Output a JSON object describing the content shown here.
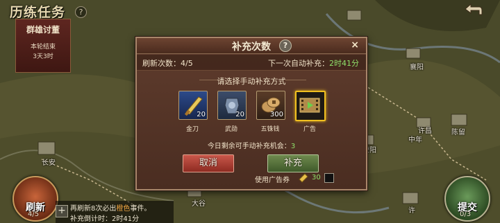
{
  "header": {
    "title": "历练任务",
    "help": "?"
  },
  "banner": {
    "title": "群雄讨董",
    "round_status": "本轮结束",
    "time_left": "3天3时"
  },
  "map_cities": [
    "襄阳",
    "陈留",
    "许昌",
    "中年",
    "荥阳",
    "长安",
    "大谷",
    "许"
  ],
  "dialog": {
    "title": "补充次数",
    "help": "?",
    "close": "×",
    "refresh_count_label": "刷新次数：",
    "refresh_count_value": "4/5",
    "next_auto_label": "下一次自动补充：",
    "next_auto_value": "2时41分",
    "choose_prompt": "请选择手动补充方式",
    "items": [
      {
        "name": "金刀",
        "count": "20",
        "icon": "golden-blade-icon"
      },
      {
        "name": "武勋",
        "count": "20",
        "icon": "military-merit-icon"
      },
      {
        "name": "五铢钱",
        "count": "300",
        "icon": "coin-icon"
      },
      {
        "name": "广告",
        "count": "",
        "icon": "ad-film-icon"
      }
    ],
    "remaining_label": "今日剩余可手动补充机会：",
    "remaining_value": "3",
    "cancel_label": "取消",
    "refill_label": "补充",
    "use_ad_ticket_label": "使用广告券",
    "ad_ticket_count": "30"
  },
  "refresh_button": {
    "label": "刷新",
    "count": "4/5"
  },
  "submit_button": {
    "label": "提交",
    "count": "0/3"
  },
  "bottom_tip": {
    "line1_prefix": "再刷新8次必出",
    "line1_highlight": "橙色",
    "line1_suffix": "事件。",
    "line2_label": "补充倒计时：",
    "line2_value": "2时41分"
  },
  "colors": {
    "accent_green": "#8fe06a",
    "cancel_red": "#b8443a",
    "refill_green": "#5a7a3e",
    "frame": "#a8866a"
  }
}
